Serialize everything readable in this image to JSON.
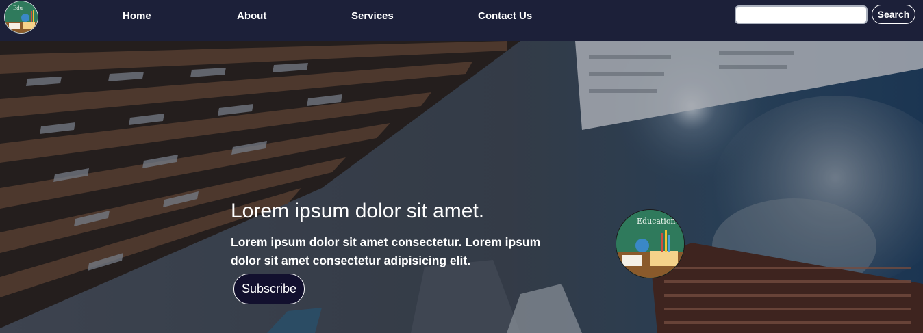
{
  "nav": {
    "logo_icon": "education-logo-icon",
    "links": [
      {
        "label": "Home"
      },
      {
        "label": "About"
      },
      {
        "label": "Services"
      },
      {
        "label": "Contact Us"
      }
    ],
    "search": {
      "value": "",
      "placeholder": "",
      "button_label": "Search"
    }
  },
  "hero": {
    "title": "Lorem ipsum dolor sit amet.",
    "description": "Lorem ipsum dolor sit amet consectetur. Lorem ipsum dolor sit amet consectetur adipisicing elit.",
    "button_label": "Subscribe",
    "badge_text": "Education",
    "background_icon": "city-buildings-image"
  },
  "colors": {
    "navbar_bg": "#1c2039",
    "button_bg": "#12102e",
    "text": "#ffffff"
  }
}
